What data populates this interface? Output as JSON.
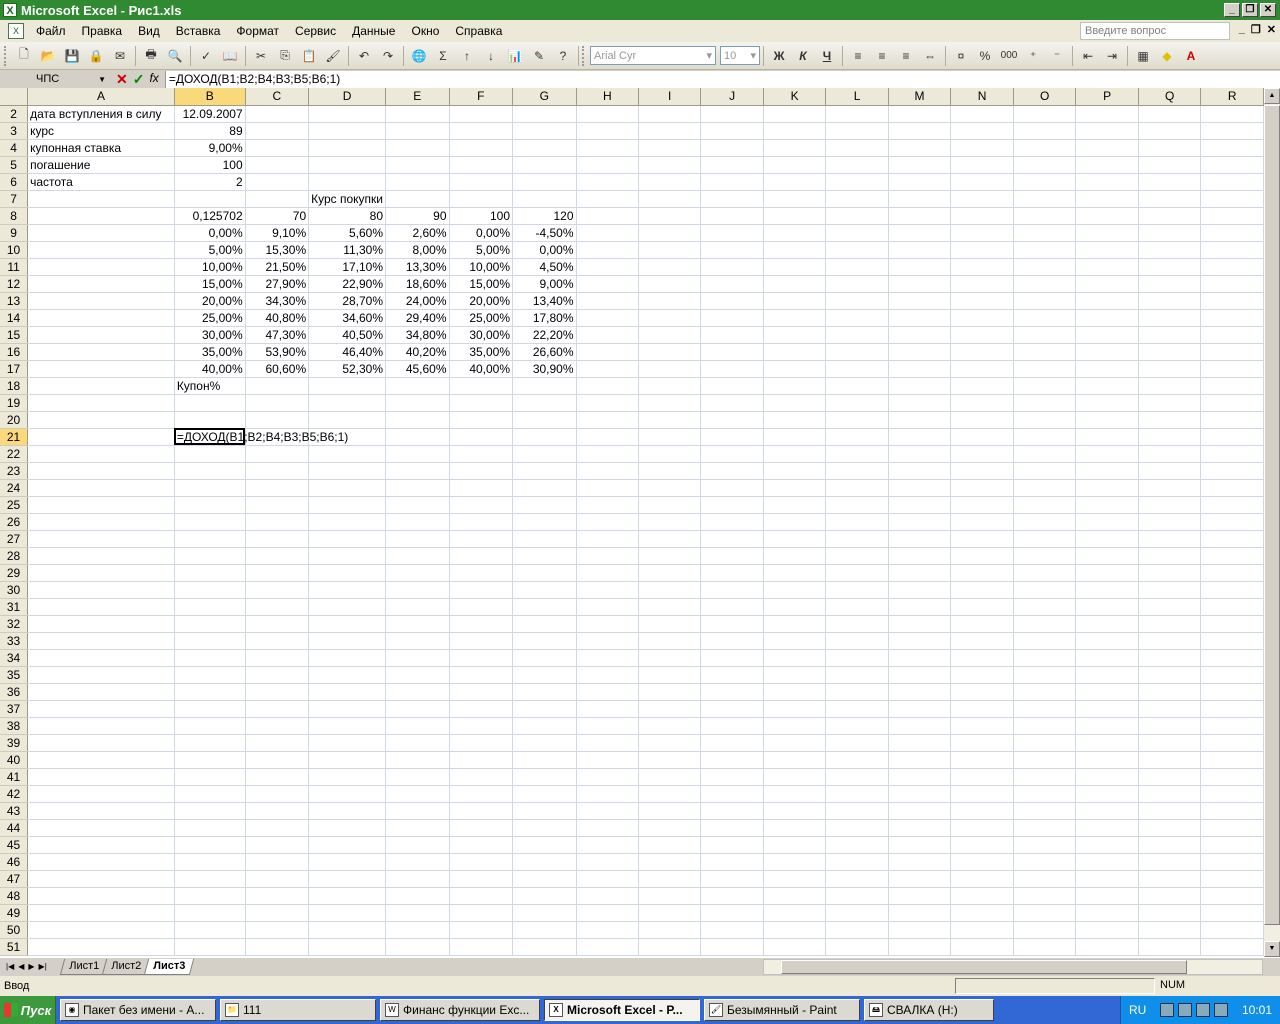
{
  "window": {
    "title": "Microsoft Excel - Рис1.xls",
    "accent": "#2f8a31",
    "controls": [
      "minimize-icon",
      "restore-icon",
      "close-icon"
    ]
  },
  "menu": {
    "items": [
      "Файл",
      "Правка",
      "Вид",
      "Вставка",
      "Формат",
      "Сервис",
      "Данные",
      "Окно",
      "Справка"
    ],
    "help_placeholder": "Введите вопрос"
  },
  "toolbar": {
    "font_name": "Arial Cyr",
    "font_size": "10",
    "bold": "Ж",
    "italic": "К",
    "underline": "Ч",
    "autosum": "Σ",
    "percent": "%",
    "thousands": "000"
  },
  "formula_bar": {
    "name_box": "ЧПС",
    "cancel": "✕",
    "enter": "✓",
    "fx": "fx",
    "formula": "=ДОХОД(B1;B2;B4;B3;B5;B6;1)"
  },
  "columns": [
    "A",
    "B",
    "C",
    "D",
    "E",
    "F",
    "G",
    "H",
    "I",
    "J",
    "K",
    "L",
    "M",
    "N",
    "O",
    "P",
    "Q",
    "R"
  ],
  "rows": [
    {
      "n": "2",
      "cells": [
        "дата вступления в силу",
        "12.09.2007",
        "",
        "",
        "",
        "",
        ""
      ]
    },
    {
      "n": "3",
      "cells": [
        "курс",
        "89",
        "",
        "",
        "",
        "",
        ""
      ]
    },
    {
      "n": "4",
      "cells": [
        "купонная ставка",
        "9,00%",
        "",
        "",
        "",
        "",
        ""
      ]
    },
    {
      "n": "5",
      "cells": [
        "погашение",
        "100",
        "",
        "",
        "",
        "",
        ""
      ]
    },
    {
      "n": "6",
      "cells": [
        "частота",
        "2",
        "",
        "",
        "",
        "",
        ""
      ]
    },
    {
      "n": "7",
      "cells": [
        "",
        "",
        "",
        "Курс покупки",
        "",
        "",
        ""
      ]
    },
    {
      "n": "8",
      "cells": [
        "",
        "0,125702",
        "70",
        "80",
        "90",
        "100",
        "120"
      ]
    },
    {
      "n": "9",
      "cells": [
        "",
        "0,00%",
        "9,10%",
        "5,60%",
        "2,60%",
        "0,00%",
        "-4,50%"
      ]
    },
    {
      "n": "10",
      "cells": [
        "",
        "5,00%",
        "15,30%",
        "11,30%",
        "8,00%",
        "5,00%",
        "0,00%"
      ]
    },
    {
      "n": "11",
      "cells": [
        "",
        "10,00%",
        "21,50%",
        "17,10%",
        "13,30%",
        "10,00%",
        "4,50%"
      ]
    },
    {
      "n": "12",
      "cells": [
        "",
        "15,00%",
        "27,90%",
        "22,90%",
        "18,60%",
        "15,00%",
        "9,00%"
      ]
    },
    {
      "n": "13",
      "cells": [
        "",
        "20,00%",
        "34,30%",
        "28,70%",
        "24,00%",
        "20,00%",
        "13,40%"
      ]
    },
    {
      "n": "14",
      "cells": [
        "",
        "25,00%",
        "40,80%",
        "34,60%",
        "29,40%",
        "25,00%",
        "17,80%"
      ]
    },
    {
      "n": "15",
      "cells": [
        "",
        "30,00%",
        "47,30%",
        "40,50%",
        "34,80%",
        "30,00%",
        "22,20%"
      ]
    },
    {
      "n": "16",
      "cells": [
        "",
        "35,00%",
        "53,90%",
        "46,40%",
        "40,20%",
        "35,00%",
        "26,60%"
      ]
    },
    {
      "n": "17",
      "cells": [
        "",
        "40,00%",
        "60,60%",
        "52,30%",
        "45,60%",
        "40,00%",
        "30,90%"
      ]
    },
    {
      "n": "18",
      "cells": [
        "",
        "Купон%",
        "",
        "",
        "",
        "",
        ""
      ]
    }
  ],
  "active_cell": {
    "row": "21",
    "col": "B",
    "text": "=ДОХОД(B1;B2;B4;B3;B5;B6;1)"
  },
  "last_row": 51,
  "sheets": {
    "tabs": [
      "Лист1",
      "Лист2",
      "Лист3"
    ],
    "active": "Лист3"
  },
  "status": {
    "mode": "Ввод",
    "num": "NUM"
  },
  "taskbar": {
    "start": "Пуск",
    "tasks": [
      "Пакет без имени - А...",
      "111",
      "Финанс функции Exc...",
      "Microsoft Excel - Р...",
      "Безымянный - Paint",
      "СВАЛКА (H:)"
    ],
    "active_task": "Microsoft Excel - Р...",
    "lang": "RU",
    "clock": "10:01"
  }
}
